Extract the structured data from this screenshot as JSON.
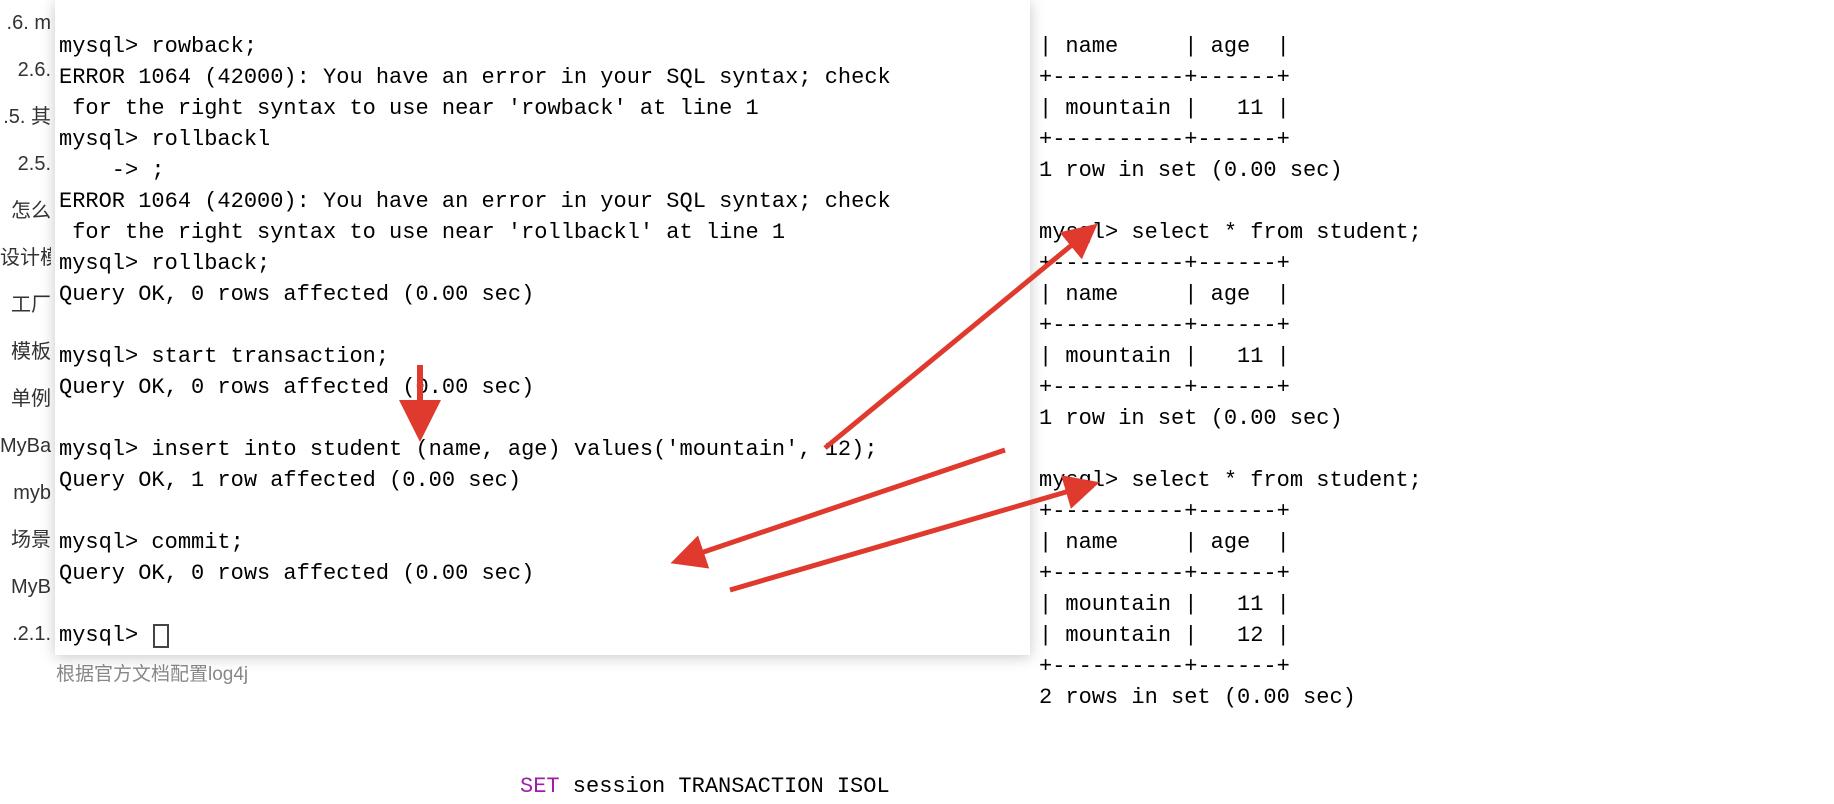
{
  "sidebar": {
    "items": [
      ".6. m",
      "2.6.",
      ".5. 其",
      "2.5.",
      "怎么",
      "设计模",
      "工厂",
      "模板",
      "单例",
      "MyBa",
      "myb",
      "场景",
      "MyB",
      ".2.1."
    ]
  },
  "left_terminal": {
    "lines": [
      "",
      "mysql> rowback;",
      "ERROR 1064 (42000): You have an error in your SQL syntax; check",
      " for the right syntax to use near 'rowback' at line 1",
      "mysql> rollbackl",
      "    -> ;",
      "ERROR 1064 (42000): You have an error in your SQL syntax; check",
      " for the right syntax to use near 'rollbackl' at line 1",
      "mysql> rollback;",
      "Query OK, 0 rows affected (0.00 sec)",
      "",
      "mysql> start transaction;",
      "Query OK, 0 rows affected (0.00 sec)",
      "",
      "mysql> insert into student (name, age) values('mountain', 12);",
      "Query OK, 1 row affected (0.00 sec)",
      "",
      "mysql> commit;",
      "Query OK, 0 rows affected (0.00 sec)",
      "",
      "mysql> "
    ]
  },
  "right_terminal": {
    "lines": [
      "",
      "| name     | age  |",
      "+----------+------+",
      "| mountain |   11 |",
      "+----------+------+",
      "1 row in set (0.00 sec)",
      "",
      "mysql> select * from student;",
      "+----------+------+",
      "| name     | age  |",
      "+----------+------+",
      "| mountain |   11 |",
      "+----------+------+",
      "1 row in set (0.00 sec)",
      "",
      "mysql> select * from student;",
      "+----------+------+",
      "| name     | age  |",
      "+----------+------+",
      "| mountain |   11 |",
      "| mountain |   12 |",
      "+----------+------+",
      "2 rows in set (0.00 sec)"
    ]
  },
  "bottom": {
    "grey_text": "根据官方文档配置log4j",
    "sql_prefix": "SET",
    "sql_rest": " session TRANSACTION ISOL"
  }
}
